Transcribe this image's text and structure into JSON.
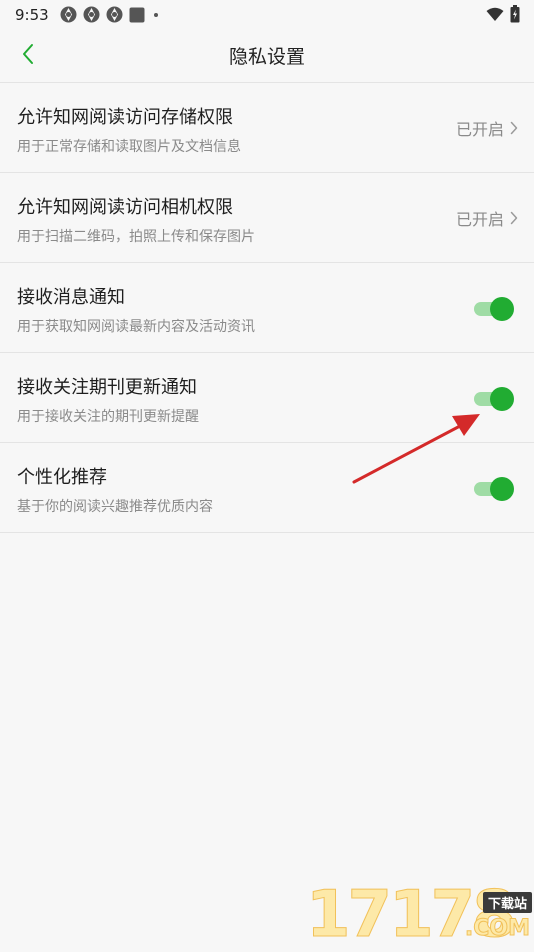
{
  "status_bar": {
    "time": "9:53",
    "left_icons": [
      "app-icon",
      "app-icon",
      "app-icon",
      "square-icon",
      "dot-icon"
    ],
    "right_icons": [
      "wifi-icon",
      "battery-icon"
    ]
  },
  "header": {
    "title": "隐私设置",
    "back_icon": "chevron-left-icon"
  },
  "settings": [
    {
      "title": "允许知网阅读访问存储权限",
      "subtitle": "用于正常存储和读取图片及文档信息",
      "control": "link",
      "status": "已开启"
    },
    {
      "title": "允许知网阅读访问相机权限",
      "subtitle": "用于扫描二维码，拍照上传和保存图片",
      "control": "link",
      "status": "已开启"
    },
    {
      "title": "接收消息通知",
      "subtitle": "用于获取知网阅读最新内容及活动资讯",
      "control": "toggle",
      "on": true
    },
    {
      "title": "接收关注期刊更新通知",
      "subtitle": "用于接收关注的期刊更新提醒",
      "control": "toggle",
      "on": true
    },
    {
      "title": "个性化推荐",
      "subtitle": "基于你的阅读兴趣推荐优质内容",
      "control": "toggle",
      "on": true
    }
  ],
  "colors": {
    "accent": "#21ac32",
    "accent_light": "#9fdca5",
    "background": "#f7f7f7",
    "divider": "#e4e4e4",
    "annotation": "#d42a2a"
  },
  "watermark": {
    "digits": "17178",
    "badge": "下载站",
    "suffix": ".COM"
  }
}
